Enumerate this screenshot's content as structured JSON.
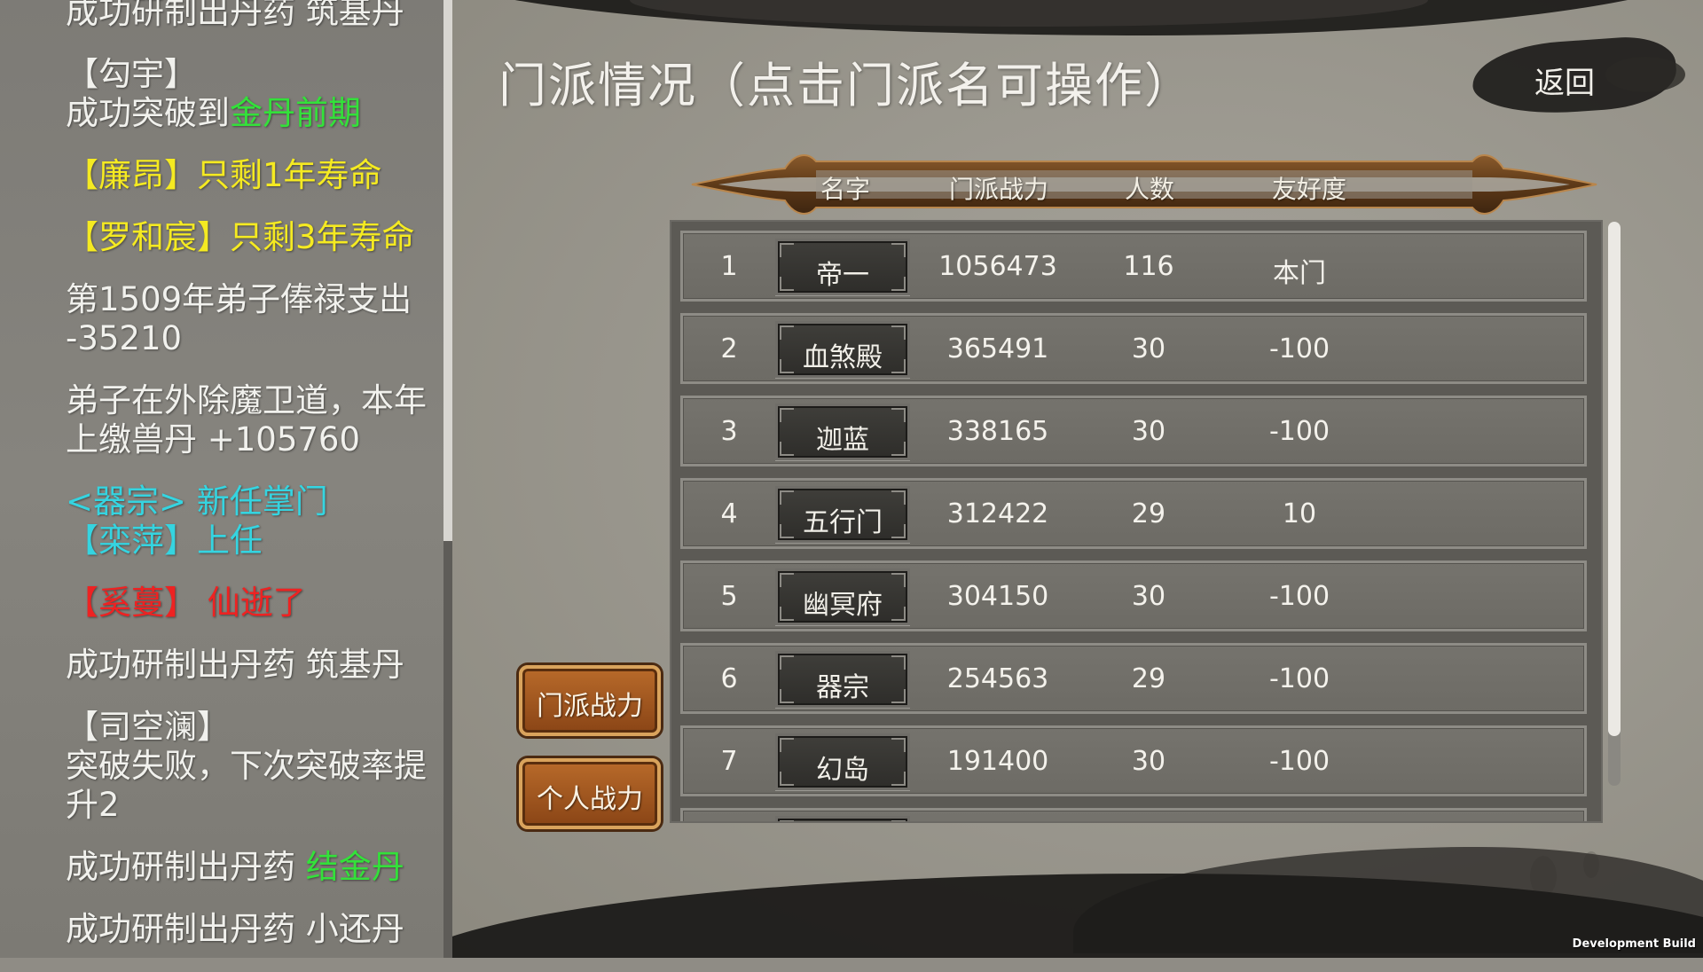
{
  "log": {
    "entries": [
      [
        {
          "text": "成功研制出丹药 筑基丹",
          "color": "white"
        }
      ],
      [
        {
          "text": "【勾宇】",
          "color": "white"
        },
        {
          "text": "\n成功突破到",
          "color": "white"
        },
        {
          "text": "金丹前期",
          "color": "green"
        }
      ],
      [
        {
          "text": "【廉昂】只剩1年寿命",
          "color": "yellow"
        }
      ],
      [
        {
          "text": "【罗和宸】只剩3年寿命",
          "color": "yellow"
        }
      ],
      [
        {
          "text": "第1509年弟子俸禄支出\n-35210",
          "color": "white"
        }
      ],
      [
        {
          "text": "弟子在外除魔卫道，本年上缴兽丹 +105760",
          "color": "white"
        }
      ],
      [
        {
          "text": "<器宗> 新任掌门\n【栾萍】上任",
          "color": "cyan"
        }
      ],
      [
        {
          "text": "【奚蔓】 仙逝了",
          "color": "red"
        }
      ],
      [
        {
          "text": "成功研制出丹药 筑基丹",
          "color": "white"
        }
      ],
      [
        {
          "text": "【司空澜】\n突破失败，下次突破率提升2",
          "color": "white"
        }
      ],
      [
        {
          "text": "成功研制出丹药 ",
          "color": "white"
        },
        {
          "text": "结金丹",
          "color": "green"
        }
      ],
      [
        {
          "text": "成功研制出丹药 小还丹",
          "color": "white"
        }
      ]
    ]
  },
  "page": {
    "title": "门派情况（点击门派名可操作）",
    "back_label": "返回",
    "dev_build": "Development Build"
  },
  "table": {
    "headers": {
      "name": "名字",
      "power": "门派战力",
      "members": "人数",
      "friendliness": "友好度"
    },
    "rows": [
      {
        "rank": "1",
        "name": "帝一",
        "power": "1056473",
        "members": "116",
        "friendliness": "本门"
      },
      {
        "rank": "2",
        "name": "血煞殿",
        "power": "365491",
        "members": "30",
        "friendliness": "-100"
      },
      {
        "rank": "3",
        "name": "迦蓝",
        "power": "338165",
        "members": "30",
        "friendliness": "-100"
      },
      {
        "rank": "4",
        "name": "五行门",
        "power": "312422",
        "members": "29",
        "friendliness": "10"
      },
      {
        "rank": "5",
        "name": "幽冥府",
        "power": "304150",
        "members": "30",
        "friendliness": "-100"
      },
      {
        "rank": "6",
        "name": "器宗",
        "power": "254563",
        "members": "29",
        "friendliness": "-100"
      },
      {
        "rank": "7",
        "name": "幻岛",
        "power": "191400",
        "members": "30",
        "friendliness": "-100"
      },
      {
        "rank": "",
        "name": "",
        "power": "",
        "members": "",
        "friendliness": ""
      }
    ]
  },
  "side_buttons": {
    "sect_power": "门派战力",
    "personal_power": "个人战力"
  },
  "colors": {
    "white": "#f1f1ed",
    "green": "#33e13a",
    "yellow": "#f5ea21",
    "cyan": "#35d4e0",
    "red": "#ee2222",
    "button_orange": "#a65a22"
  }
}
